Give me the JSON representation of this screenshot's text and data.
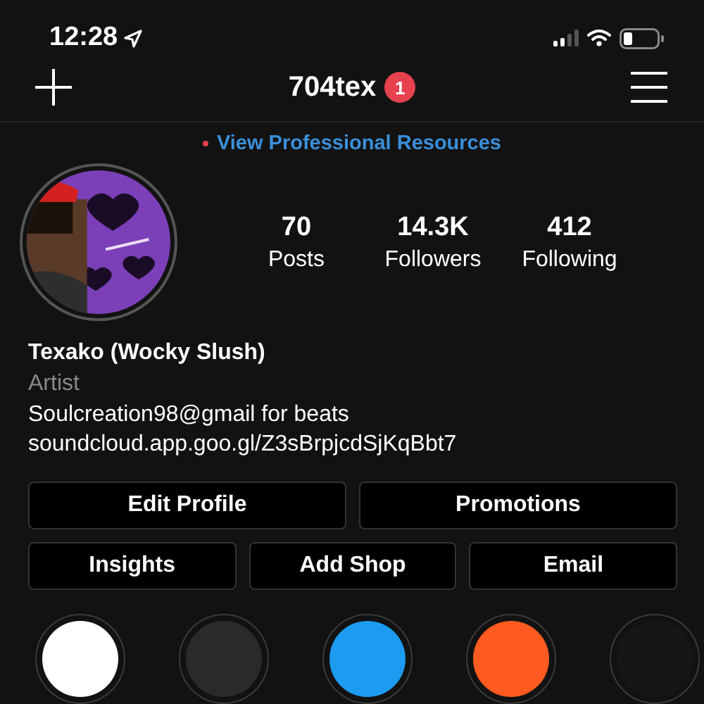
{
  "status_bar": {
    "time": "12:28"
  },
  "header": {
    "username": "704tex",
    "badge": "1"
  },
  "resources_link": {
    "label": "View Professional Resources"
  },
  "stats": [
    {
      "value": "70",
      "label": "Posts"
    },
    {
      "value": "14.3K",
      "label": "Followers"
    },
    {
      "value": "412",
      "label": "Following"
    }
  ],
  "bio": {
    "name": "Texako (Wocky Slush)",
    "category": "Artist",
    "lines": [
      "Soulcreation98@gmail for beats",
      "soundcloud.app.goo.gl/Z3sBrpjcdSjKqBbt7"
    ]
  },
  "buttons": [
    [
      "Edit Profile",
      "Promotions"
    ],
    [
      "Insights",
      "Add Shop",
      "Email"
    ]
  ],
  "highlights": [
    {
      "color": "#ffffff"
    },
    {
      "color": "#2a2a2a"
    },
    {
      "color": "#1d9bf0"
    },
    {
      "color": "#ff5a1f"
    },
    {
      "color": "#161616"
    }
  ]
}
